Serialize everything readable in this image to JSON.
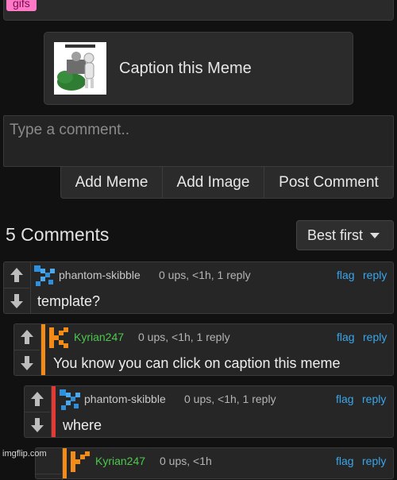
{
  "top": {
    "tag_label": "gifs"
  },
  "caption_card": {
    "label": "Caption this Meme"
  },
  "comment_input": {
    "placeholder": "Type a comment.."
  },
  "actions": {
    "add_meme": "Add Meme",
    "add_image": "Add Image",
    "post_comment": "Post Comment"
  },
  "comments_header": {
    "count_label": "5 Comments",
    "sort_label": "Best first"
  },
  "comments": [
    {
      "username": "phantom-skibble",
      "meta": "0 ups, <1h, 1 reply",
      "flag": "flag",
      "reply": "reply",
      "text": "template?",
      "username_color": "#c8c8c8",
      "accent_color": "#3a9be0"
    },
    {
      "username": "Kyrian247",
      "meta": "0 ups, <1h, 1 reply",
      "flag": "flag",
      "reply": "reply",
      "text": "You know you can click on caption this meme",
      "username_color": "#4cc94c",
      "accent_color": "#f28b17"
    },
    {
      "username": "phantom-skibble",
      "meta": "0 ups, <1h, 1 reply",
      "flag": "flag",
      "reply": "reply",
      "text": "where",
      "username_color": "#c8c8c8",
      "accent_color": "#e53935"
    },
    {
      "username": "Kyrian247",
      "meta": "0 ups, <1h",
      "flag": "flag",
      "reply": "reply",
      "text": "",
      "username_color": "#4cc94c",
      "accent_color": "#f28b17"
    }
  ],
  "watermark": "imgflip.com"
}
